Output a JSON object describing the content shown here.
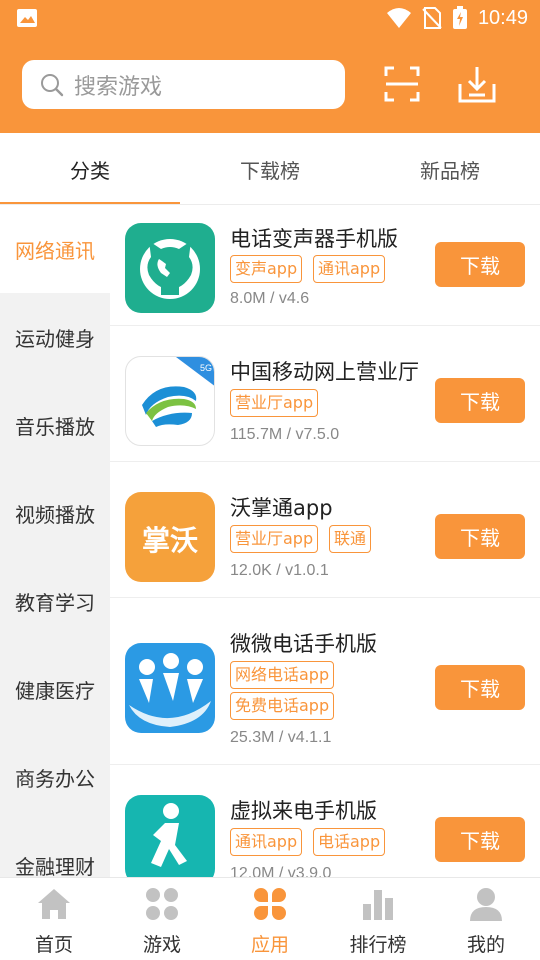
{
  "colors": {
    "accent": "#f9953b",
    "sidebar_bg": "#f2f2f2",
    "text_muted": "#888888"
  },
  "status_bar": {
    "time": "10:49",
    "icons": [
      "image-icon",
      "wifi-icon",
      "no-sim-icon",
      "battery-icon"
    ]
  },
  "search": {
    "placeholder": "搜索游戏"
  },
  "header_actions": {
    "scan_icon": "scan-icon",
    "download_icon": "download-icon"
  },
  "tabs": [
    {
      "label": "分类",
      "active": true
    },
    {
      "label": "下载榜",
      "active": false
    },
    {
      "label": "新品榜",
      "active": false
    }
  ],
  "sidebar": {
    "items": [
      {
        "label": "网络通讯",
        "active": true
      },
      {
        "label": "运动健身",
        "active": false
      },
      {
        "label": "音乐播放",
        "active": false
      },
      {
        "label": "视频播放",
        "active": false
      },
      {
        "label": "教育学习",
        "active": false
      },
      {
        "label": "健康医疗",
        "active": false
      },
      {
        "label": "商务办公",
        "active": false
      },
      {
        "label": "金融理财",
        "active": false
      }
    ]
  },
  "apps": [
    {
      "name": "电话变声器手机版",
      "tags": [
        "变声app",
        "通讯app"
      ],
      "meta": "8.0M / v4.6",
      "button": "下载",
      "icon": "cat-phone-app-icon"
    },
    {
      "name": "中国移动网上营业厅",
      "tags": [
        "营业厅app"
      ],
      "meta": "115.7M / v7.5.0",
      "button": "下载",
      "icon": "china-mobile-app-icon"
    },
    {
      "name": "沃掌通app",
      "tags": [
        "营业厅app",
        "联通"
      ],
      "meta": "12.0K / v1.0.1",
      "button": "下载",
      "icon": "wozhangtong-app-icon",
      "icon_text": "掌沃"
    },
    {
      "name": "微微电话手机版",
      "tags": [
        "网络电话app",
        "免费电话app"
      ],
      "meta": "25.3M / v4.1.1",
      "button": "下载",
      "icon": "weiwei-app-icon"
    },
    {
      "name": "虚拟来电手机版",
      "tags": [
        "通讯app",
        "电话app"
      ],
      "meta": "12.0M / v3.9.0",
      "button": "下载",
      "icon": "running-man-app-icon"
    }
  ],
  "bottom_nav": [
    {
      "label": "首页",
      "icon": "home-icon",
      "active": false
    },
    {
      "label": "游戏",
      "icon": "game-grid-icon",
      "active": false
    },
    {
      "label": "应用",
      "icon": "apps-icon",
      "active": true
    },
    {
      "label": "排行榜",
      "icon": "bar-chart-icon",
      "active": false
    },
    {
      "label": "我的",
      "icon": "user-icon",
      "active": false
    }
  ]
}
